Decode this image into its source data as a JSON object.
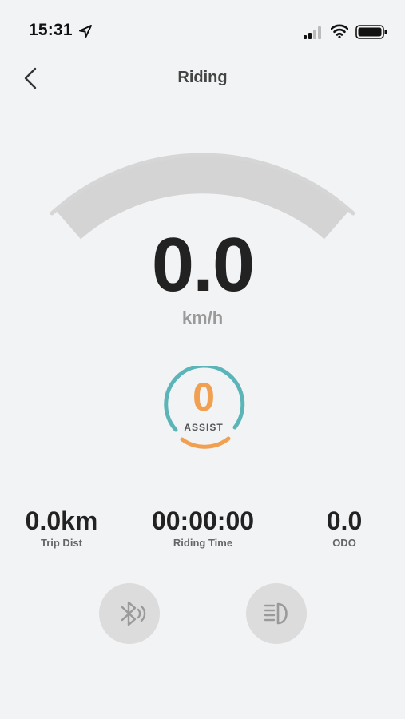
{
  "status_bar": {
    "time": "15:31",
    "icons": [
      "location-arrow-icon",
      "cellular-signal-icon",
      "wifi-icon",
      "battery-icon"
    ]
  },
  "nav": {
    "title": "Riding",
    "back_icon": "chevron-left-icon"
  },
  "gauge": {
    "speed": "0.0",
    "unit": "km/h",
    "level": 0
  },
  "assist": {
    "level": "0",
    "label": "ASSIST"
  },
  "stats": {
    "trip_dist": {
      "value": "0.0km",
      "label": "Trip Dist"
    },
    "riding_time": {
      "value": "00:00:00",
      "label": "Riding Time"
    },
    "odo": {
      "value": "0.0",
      "label": "ODO"
    }
  },
  "controls": {
    "bluetooth_icon": "bluetooth-icon",
    "headlight_icon": "headlight-icon"
  },
  "colors": {
    "background": "#f2f3f5",
    "gauge_track": "#d4d4d4",
    "assist_teal": "#5bb5b8",
    "assist_orange": "#f0a050",
    "button_bg": "#dcdcdc",
    "icon_gray": "#9a9a9a"
  }
}
